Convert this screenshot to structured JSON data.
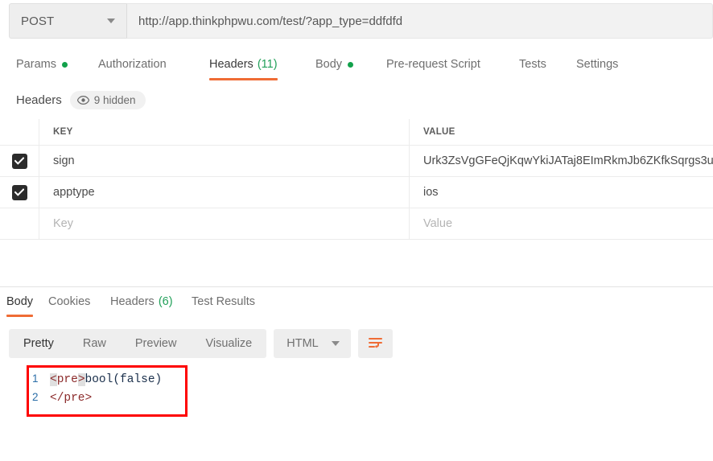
{
  "request": {
    "method": "POST",
    "url": "http://app.thinkphpwu.com/test/?app_type=ddfdfd",
    "tabs": [
      {
        "label": "Params",
        "dot": true,
        "count": null,
        "active": false
      },
      {
        "label": "Authorization",
        "dot": false,
        "count": null,
        "active": false
      },
      {
        "label": "Headers",
        "dot": false,
        "count": "(11)",
        "active": true
      },
      {
        "label": "Body",
        "dot": true,
        "count": null,
        "active": false
      },
      {
        "label": "Pre-request Script",
        "dot": false,
        "count": null,
        "active": false
      },
      {
        "label": "Tests",
        "dot": false,
        "count": null,
        "active": false
      },
      {
        "label": "Settings",
        "dot": false,
        "count": null,
        "active": false
      }
    ]
  },
  "headers_panel": {
    "title": "Headers",
    "hidden_label": "9 hidden",
    "columns": {
      "key": "KEY",
      "value": "VALUE"
    },
    "rows": [
      {
        "checked": true,
        "key": "sign",
        "value": "Urk3ZsVgGFeQjKqwYkiJATaj8EImRkmJb6ZKfkSqrgs3u"
      },
      {
        "checked": true,
        "key": "apptype",
        "value": "ios"
      }
    ],
    "new_row": {
      "key_placeholder": "Key",
      "value_placeholder": "Value"
    }
  },
  "response": {
    "tabs": [
      {
        "label": "Body",
        "count": null,
        "active": true
      },
      {
        "label": "Cookies",
        "count": null,
        "active": false
      },
      {
        "label": "Headers",
        "count": "(6)",
        "active": false
      },
      {
        "label": "Test Results",
        "count": null,
        "active": false
      }
    ],
    "view_modes": [
      {
        "label": "Pretty",
        "active": true
      },
      {
        "label": "Raw",
        "active": false
      },
      {
        "label": "Preview",
        "active": false
      },
      {
        "label": "Visualize",
        "active": false
      }
    ],
    "format": "HTML",
    "wrap_icon": "word-wrap-icon",
    "body_lines": [
      {
        "num": "1",
        "open_bracket": "<",
        "tag": "pre",
        "close_bracket": ">",
        "rest": "bool(false)"
      },
      {
        "num": "2",
        "text": "</pre>"
      }
    ]
  },
  "colors": {
    "accent": "#ef6c35",
    "green": "#12a14b",
    "annotation": "#fe0000",
    "checkbox": "#2b2b2b"
  }
}
